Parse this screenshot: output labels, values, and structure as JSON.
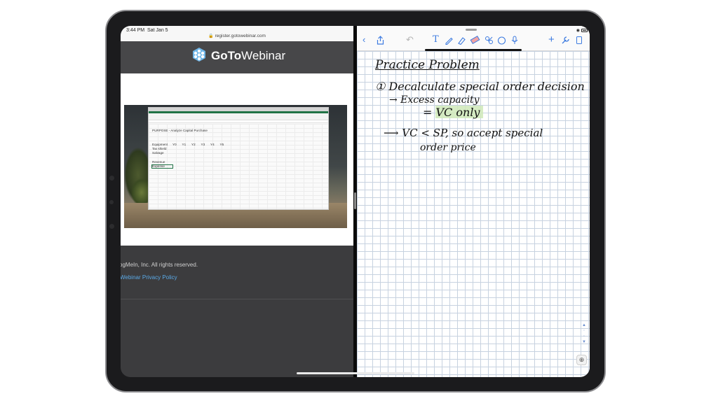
{
  "browser": {
    "time": "3:44 PM",
    "date": "Sat Jan 5",
    "url": "register.gotowebinar.com"
  },
  "gotowebinar": {
    "logo_text_bold": "GoTo",
    "logo_text_regular": "Webinar",
    "copyright": "ogMeIn, Inc. All rights reserved.",
    "privacy_link": "Webinar Privacy Policy"
  },
  "spreadsheet": {
    "title_cell": "PURPOSE - Analyze Capital Purchase",
    "columns": [
      "Y0",
      "Y1",
      "Y2",
      "Y3",
      "Y4",
      "Y5"
    ],
    "rows": [
      "Equipment",
      "Tax shield",
      "Salvage",
      "Revenue",
      "Expense"
    ]
  },
  "notes": {
    "title": "Practice Problem",
    "line1": "① Decalculate special order decision",
    "line2": "→ Excess capacity",
    "line3": "= VC only",
    "line4": "⟶ VC < SP, so accept special",
    "line5": "order price"
  },
  "toolbar": {
    "icons": [
      "back-icon",
      "share-icon",
      "undo-icon",
      "text-tool-icon",
      "pen-icon",
      "highlighter-icon",
      "eraser-icon",
      "lasso-icon",
      "shapes-icon",
      "mic-icon",
      "add-icon",
      "wrench-icon",
      "pages-icon"
    ]
  },
  "colors": {
    "link": "#5aa9e6",
    "header_bg": "#474749",
    "accent_blue": "#3d7be0",
    "highlight": "#cfe9b8"
  }
}
